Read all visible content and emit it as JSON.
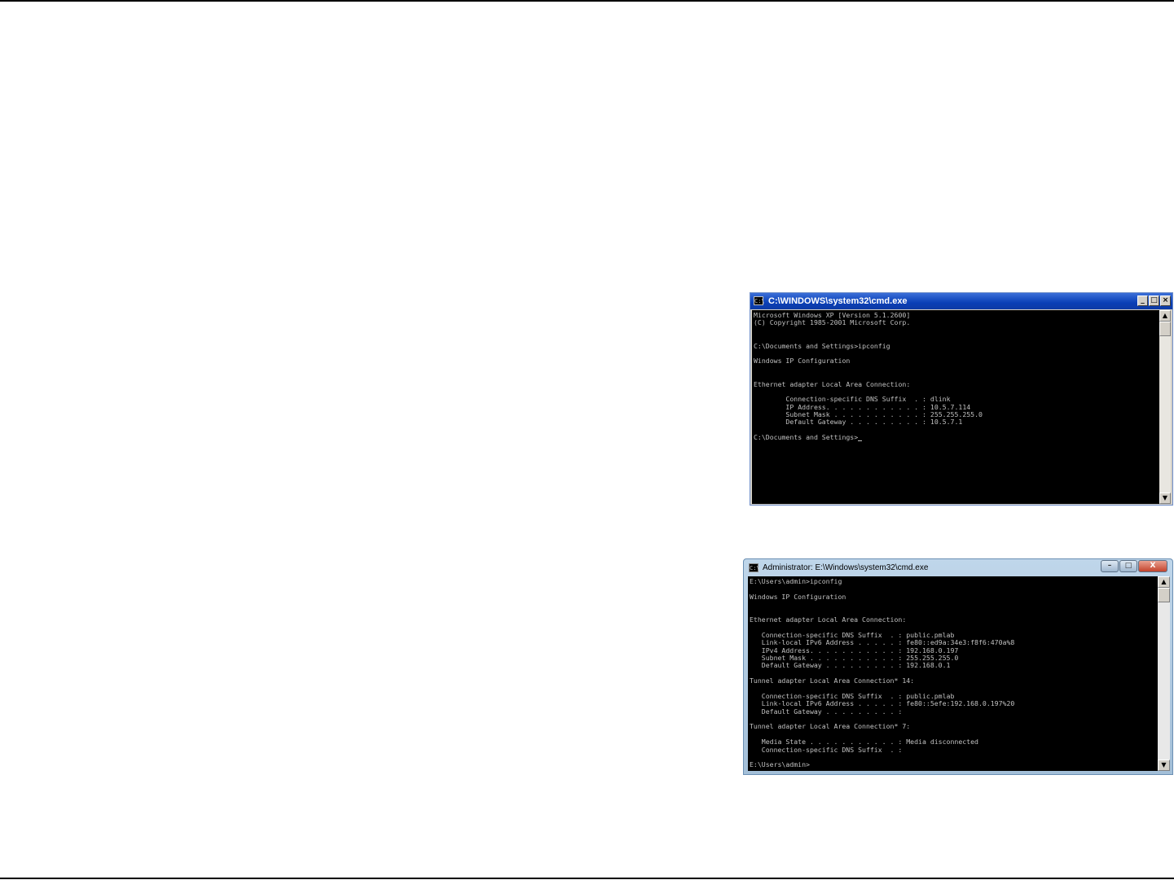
{
  "xp_window": {
    "title": "C:\\WINDOWS\\system32\\cmd.exe",
    "icon_glyph": "C:\\",
    "controls": {
      "minimize": "_",
      "maximize": "□",
      "close": "×"
    },
    "lines": [
      "Microsoft Windows XP [Version 5.1.2600]",
      "(C) Copyright 1985-2001 Microsoft Corp.",
      "",
      "",
      "C:\\Documents and Settings>ipconfig",
      "",
      "Windows IP Configuration",
      "",
      "",
      "Ethernet adapter Local Area Connection:",
      "",
      "        Connection-specific DNS Suffix  . : dlink",
      "        IP Address. . . . . . . . . . . . : 10.5.7.114",
      "        Subnet Mask . . . . . . . . . . . : 255.255.255.0",
      "        Default Gateway . . . . . . . . . : 10.5.7.1",
      "",
      "C:\\Documents and Settings>"
    ]
  },
  "vista_window": {
    "title": "Administrator: E:\\Windows\\system32\\cmd.exe",
    "icon_glyph": "C:\\",
    "controls": {
      "minimize": "–",
      "maximize": "□",
      "close": "X"
    },
    "lines": [
      "E:\\Users\\admin>ipconfig",
      "",
      "Windows IP Configuration",
      "",
      "",
      "Ethernet adapter Local Area Connection:",
      "",
      "   Connection-specific DNS Suffix  . : public.pmlab",
      "   Link-local IPv6 Address . . . . . : fe80::ed9a:34e3:f8f6:470a%8",
      "   IPv4 Address. . . . . . . . . . . : 192.168.0.197",
      "   Subnet Mask . . . . . . . . . . . : 255.255.255.0",
      "   Default Gateway . . . . . . . . . : 192.168.0.1",
      "",
      "Tunnel adapter Local Area Connection* 14:",
      "",
      "   Connection-specific DNS Suffix  . : public.pmlab",
      "   Link-local IPv6 Address . . . . . : fe80::5efe:192.168.0.197%20",
      "   Default Gateway . . . . . . . . . :",
      "",
      "Tunnel adapter Local Area Connection* 7:",
      "",
      "   Media State . . . . . . . . . . . : Media disconnected",
      "   Connection-specific DNS Suffix  . :",
      "",
      "E:\\Users\\admin>"
    ]
  },
  "scrollbar": {
    "up": "▲",
    "down": "▼"
  }
}
